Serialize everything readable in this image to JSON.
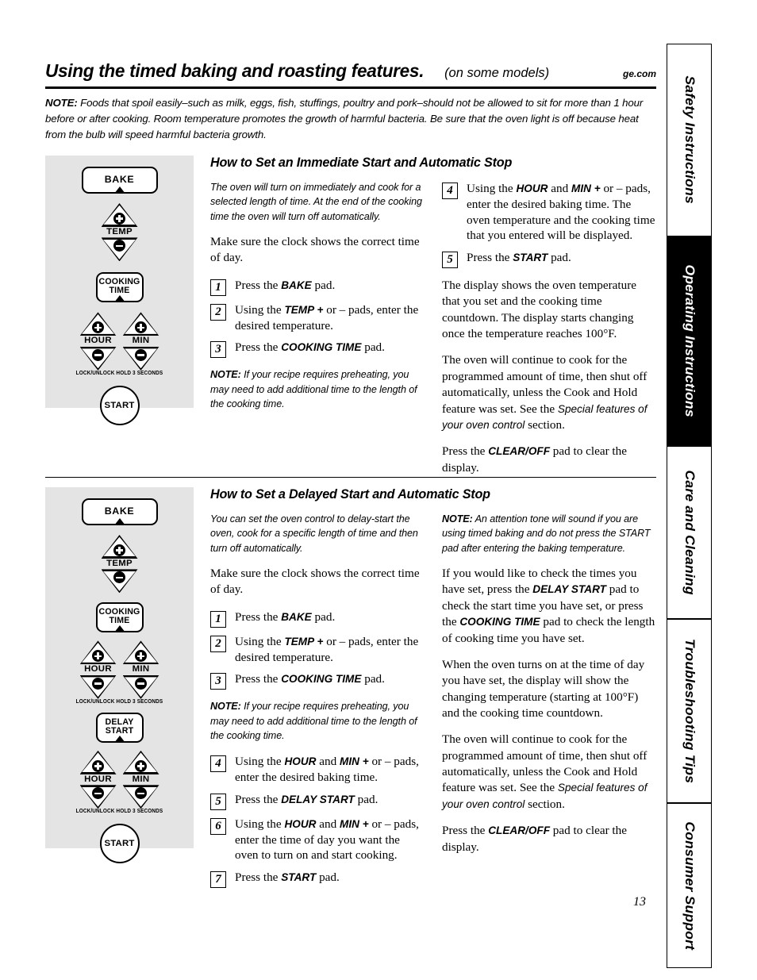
{
  "header": {
    "title": "Using the timed baking and roasting features.",
    "subtitle": "(on some models)",
    "site": "ge.com",
    "note_label": "NOTE:",
    "note_text": " Foods that spoil easily–such as milk, eggs, fish, stuffings, poultry and pork–should not be allowed to sit for more than 1 hour before or after cooking. Room temperature promotes the growth of harmful bacteria. Be sure that the oven light is off because heat from the bulb will speed harmful bacteria growth."
  },
  "tabs": [
    {
      "label": "Safety Instructions",
      "active": false
    },
    {
      "label": "Operating Instructions",
      "active": true
    },
    {
      "label": "Care and Cleaning",
      "active": false
    },
    {
      "label": "Troubleshooting Tips",
      "active": false
    },
    {
      "label": "Consumer Support",
      "active": false
    }
  ],
  "control_panel_1": {
    "bake": "BAKE",
    "temp": "TEMP",
    "cooking_time_l1": "COOKING",
    "cooking_time_l2": "TIME",
    "hour": "HOUR",
    "min": "MIN",
    "lock_note": "LOCK/UNLOCK HOLD 3 SECONDS",
    "start": "START"
  },
  "control_panel_2": {
    "bake": "BAKE",
    "temp": "TEMP",
    "cooking_time_l1": "COOKING",
    "cooking_time_l2": "TIME",
    "hour": "HOUR",
    "min": "MIN",
    "lock_note": "LOCK/UNLOCK HOLD 3 SECONDS",
    "delay_l1": "DELAY",
    "delay_l2": "START",
    "hour2": "HOUR",
    "min2": "MIN",
    "lock_note2": "LOCK/UNLOCK HOLD 3 SECONDS",
    "start": "START"
  },
  "section1": {
    "heading": "How to Set an Immediate Start and Automatic Stop",
    "intro_italic": "The oven will turn on immediately and cook for a selected length of time. At the end of the cooking time the oven will turn off automatically.",
    "clock_para": "Make sure the clock shows the correct time of day.",
    "steps": [
      {
        "num": "1",
        "pre": "Press the ",
        "bold": "BAKE",
        "post": " pad."
      },
      {
        "num": "2",
        "pre": "Using the ",
        "bold": "TEMP +",
        "post": " or – pads, enter the desired temperature."
      },
      {
        "num": "3",
        "pre": "Press the ",
        "bold": "COOKING TIME",
        "post": " pad."
      }
    ],
    "note_label": "NOTE:",
    "note_text": " If your recipe requires preheating, you may need to add additional time to the length of the cooking time.",
    "steps_right": [
      {
        "num": "4",
        "pre": "Using the ",
        "bold": "HOUR",
        "mid": " and ",
        "bold2": "MIN +",
        "post": " or – pads, enter the desired baking time. The oven temperature and the cooking time that you entered will be displayed."
      },
      {
        "num": "5",
        "pre": "Press the ",
        "bold": "START",
        "post": " pad."
      }
    ],
    "para_display": "The display shows the oven temperature that you set and the cooking time countdown. The display starts changing once the temperature reaches 100°F.",
    "para_continue_a": "The oven will continue to cook for the programmed amount of time, then shut off automatically, unless the Cook and Hold feature was set. See the ",
    "para_continue_italic": "Special features of your oven control",
    "para_continue_b": " section.",
    "para_clear_a": "Press the ",
    "para_clear_bold": "CLEAR/OFF",
    "para_clear_b": " pad to clear the display."
  },
  "section2": {
    "heading": "How to Set a Delayed Start and Automatic Stop",
    "intro_italic": "You can set the oven control to delay-start the oven, cook for a specific length of time and then turn off automatically.",
    "clock_para": "Make sure the clock shows the correct time of day.",
    "steps": [
      {
        "num": "1",
        "pre": "Press the ",
        "bold": "BAKE",
        "post": " pad."
      },
      {
        "num": "2",
        "pre": "Using the ",
        "bold": "TEMP +",
        "post": " or – pads, enter the desired temperature."
      },
      {
        "num": "3",
        "pre": "Press the ",
        "bold": "COOKING TIME",
        "post": " pad."
      }
    ],
    "note_label": "NOTE:",
    "note_text": " If your recipe requires preheating, you may need to add additional time to the length of the cooking time.",
    "steps_after_note": [
      {
        "num": "4",
        "pre": "Using the ",
        "bold": "HOUR",
        "mid": " and ",
        "bold2": "MIN +",
        "post": " or – pads, enter the desired baking time."
      },
      {
        "num": "5",
        "pre": "Press the ",
        "bold": "DELAY START",
        "post": " pad."
      },
      {
        "num": "6",
        "pre": "Using the ",
        "bold": "HOUR",
        "mid": " and ",
        "bold2": "MIN +",
        "post": " or – pads, enter the time of day you want the oven to turn on and start cooking."
      },
      {
        "num": "7",
        "pre": "Press the ",
        "bold": "START",
        "post": " pad."
      }
    ],
    "note2_label": "NOTE:",
    "note2_text": " An attention tone will sound if you are using timed baking and do not press the START pad after entering the baking temperature.",
    "para_check_a": "If you would like to check the times you have set, press the ",
    "para_check_bold1": "DELAY START",
    "para_check_b": " pad to check the start time you have set, or press the ",
    "para_check_bold2": "COOKING TIME",
    "para_check_c": " pad to check the length of cooking time you have set.",
    "para_turnson": "When the oven turns on at the time of day you have set, the display will show the changing temperature (starting at 100°F) and the cooking time countdown.",
    "para_continue_a": "The oven will continue to cook for the programmed amount of time, then shut off automatically, unless the Cook and Hold feature was set. See the ",
    "para_continue_italic": "Special features of your oven control",
    "para_continue_b": " section.",
    "para_clear_a": "Press the ",
    "para_clear_bold": "CLEAR/OFF",
    "para_clear_b": " pad to clear the display."
  },
  "footer": {
    "page_number": "13"
  }
}
